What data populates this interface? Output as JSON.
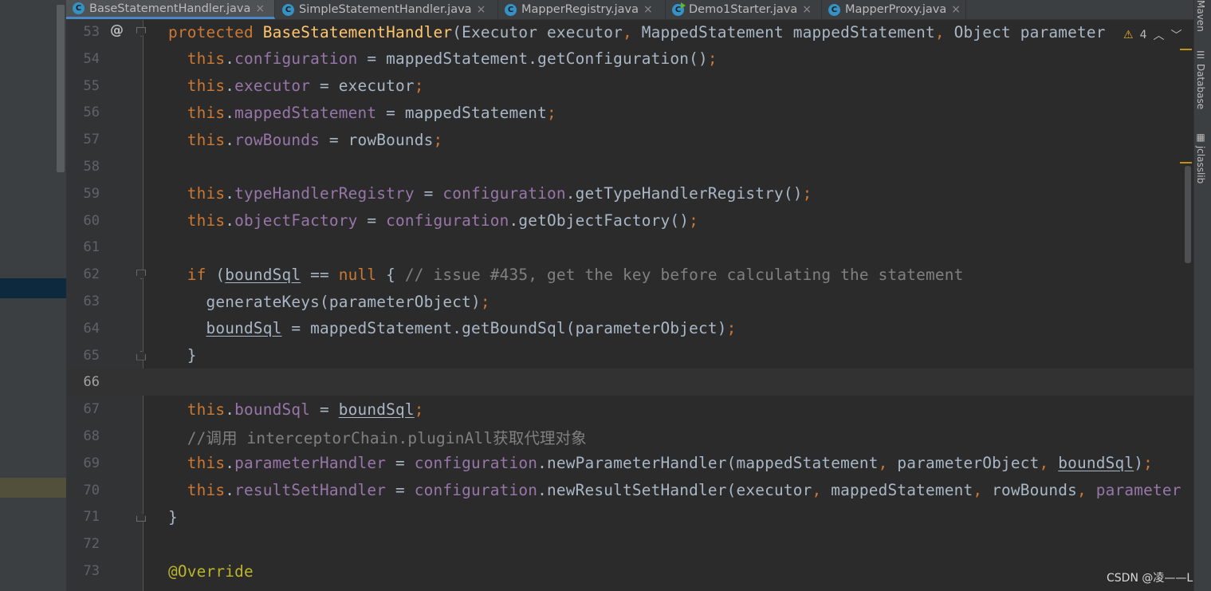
{
  "tabs": [
    {
      "label": "BaseStatementHandler.java",
      "icon": "c",
      "active": true
    },
    {
      "label": "SimpleStatementHandler.java",
      "icon": "c"
    },
    {
      "label": "MapperRegistry.java",
      "icon": "c"
    },
    {
      "label": "Demo1Starter.java",
      "icon": "c"
    },
    {
      "label": "MapperProxy.java",
      "icon": "c"
    }
  ],
  "tab_close_glyph": "×",
  "inspection": {
    "warning_count": "4",
    "up": "︿",
    "down": "﹀"
  },
  "right_tools": [
    "Maven",
    "Database",
    "jclasslib"
  ],
  "watermark": "CSDN @凌——L",
  "current_line": "66",
  "editor_lines": [
    {
      "n": "53",
      "t": [
        [
          "kw",
          "protected "
        ],
        [
          "fn",
          "BaseStatementHandler"
        ],
        [
          "",
          "(Executor executor"
        ],
        [
          "kw",
          ", "
        ],
        [
          "",
          "MappedStatement mappedStatement"
        ],
        [
          "kw",
          ", "
        ],
        [
          "",
          "Object parameter"
        ]
      ]
    },
    {
      "n": "54",
      "t": [
        [
          "",
          "  "
        ],
        [
          "kw",
          "this"
        ],
        [
          "",
          "."
        ],
        [
          "fld",
          "configuration"
        ],
        [
          "",
          " = mappedStatement.getConfiguration()"
        ],
        [
          "kw",
          ";"
        ]
      ]
    },
    {
      "n": "55",
      "t": [
        [
          "",
          "  "
        ],
        [
          "kw",
          "this"
        ],
        [
          "",
          "."
        ],
        [
          "fld",
          "executor"
        ],
        [
          "",
          " = executor"
        ],
        [
          "kw",
          ";"
        ]
      ]
    },
    {
      "n": "56",
      "t": [
        [
          "",
          "  "
        ],
        [
          "kw",
          "this"
        ],
        [
          "",
          "."
        ],
        [
          "fld",
          "mappedStatement"
        ],
        [
          "",
          " = mappedStatement"
        ],
        [
          "kw",
          ";"
        ]
      ]
    },
    {
      "n": "57",
      "t": [
        [
          "",
          "  "
        ],
        [
          "kw",
          "this"
        ],
        [
          "",
          "."
        ],
        [
          "fld",
          "rowBounds"
        ],
        [
          "",
          " = rowBounds"
        ],
        [
          "kw",
          ";"
        ]
      ]
    },
    {
      "n": "58",
      "t": []
    },
    {
      "n": "59",
      "t": [
        [
          "",
          "  "
        ],
        [
          "kw",
          "this"
        ],
        [
          "",
          "."
        ],
        [
          "fld",
          "typeHandlerRegistry"
        ],
        [
          "",
          " = "
        ],
        [
          "fld",
          "configuration"
        ],
        [
          "",
          ".getTypeHandlerRegistry()"
        ],
        [
          "kw",
          ";"
        ]
      ]
    },
    {
      "n": "60",
      "t": [
        [
          "",
          "  "
        ],
        [
          "kw",
          "this"
        ],
        [
          "",
          "."
        ],
        [
          "fld",
          "objectFactory"
        ],
        [
          "",
          " = "
        ],
        [
          "fld",
          "configuration"
        ],
        [
          "",
          ".getObjectFactory()"
        ],
        [
          "kw",
          ";"
        ]
      ]
    },
    {
      "n": "61",
      "t": []
    },
    {
      "n": "62",
      "t": [
        [
          "",
          "  "
        ],
        [
          "kw",
          "if "
        ],
        [
          "",
          "("
        ],
        [
          "ul",
          "boundSql"
        ],
        [
          "",
          " == "
        ],
        [
          "kw",
          "null"
        ],
        [
          "",
          " { "
        ],
        [
          "cm",
          "// issue #435, get the key before calculating the statement"
        ]
      ]
    },
    {
      "n": "63",
      "t": [
        [
          "",
          "    generateKeys(parameterObject)"
        ],
        [
          "kw",
          ";"
        ]
      ]
    },
    {
      "n": "64",
      "t": [
        [
          "",
          "    "
        ],
        [
          "ul",
          "boundSql"
        ],
        [
          "",
          " = mappedStatement.getBoundSql(parameterObject)"
        ],
        [
          "kw",
          ";"
        ]
      ]
    },
    {
      "n": "65",
      "t": [
        [
          "",
          "  }"
        ]
      ]
    },
    {
      "n": "66",
      "t": []
    },
    {
      "n": "67",
      "t": [
        [
          "",
          "  "
        ],
        [
          "kw",
          "this"
        ],
        [
          "",
          "."
        ],
        [
          "fld",
          "boundSql"
        ],
        [
          "",
          " = "
        ],
        [
          "ul",
          "boundSql"
        ],
        [
          "kw",
          ";"
        ]
      ]
    },
    {
      "n": "68",
      "t": [
        [
          "cm",
          "  //调用 interceptorChain.pluginAll获取代理对象"
        ]
      ]
    },
    {
      "n": "69",
      "t": [
        [
          "",
          "  "
        ],
        [
          "kw",
          "this"
        ],
        [
          "",
          "."
        ],
        [
          "fld",
          "parameterHandler"
        ],
        [
          "",
          " = "
        ],
        [
          "fld",
          "configuration"
        ],
        [
          "",
          ".newParameterHandler(mappedStatement"
        ],
        [
          "kw",
          ", "
        ],
        [
          "",
          "parameterObject"
        ],
        [
          "kw",
          ", "
        ],
        [
          "ul",
          "boundSql"
        ],
        [
          "",
          ")"
        ],
        [
          "kw",
          ";"
        ]
      ]
    },
    {
      "n": "70",
      "t": [
        [
          "",
          "  "
        ],
        [
          "kw",
          "this"
        ],
        [
          "",
          "."
        ],
        [
          "fld",
          "resultSetHandler"
        ],
        [
          "",
          " = "
        ],
        [
          "fld",
          "configuration"
        ],
        [
          "",
          ".newResultSetHandler(executor"
        ],
        [
          "kw",
          ", "
        ],
        [
          "",
          "mappedStatement"
        ],
        [
          "kw",
          ", "
        ],
        [
          "",
          "rowBounds"
        ],
        [
          "kw",
          ", "
        ],
        [
          "fld",
          "parameter"
        ]
      ]
    },
    {
      "n": "71",
      "t": [
        [
          "",
          "}"
        ]
      ]
    },
    {
      "n": "72",
      "t": []
    },
    {
      "n": "73",
      "t": [
        [
          "an",
          "@Override"
        ]
      ]
    }
  ]
}
